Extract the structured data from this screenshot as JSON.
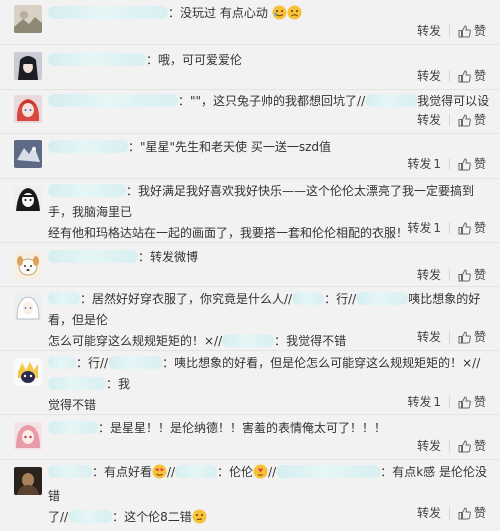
{
  "comments": [
    {
      "text": "：没玩过 有点心动",
      "forward": "转发",
      "like": "赞",
      "forward_count": "",
      "like_count": "",
      "avatar": "landscape-avatar-icon"
    },
    {
      "text": "：哦，可可爱爱伦",
      "forward": "转发",
      "like": "赞",
      "forward_count": "",
      "like_count": "",
      "avatar": "anime-black-hair-avatar-icon"
    },
    {
      "text_a": "：\"\"，这只兔子帅的我都想回坑了//",
      "text_b": "我觉得可以设",
      "forward": "转发",
      "like": "赞",
      "forward_count": "",
      "like_count": "",
      "avatar": "anime-red-hair-avatar-icon"
    },
    {
      "text": "：\"星星\"先生和老天使 买一送一szd值",
      "forward": "转发",
      "like": "赞",
      "forward_count": "1",
      "like_count": "",
      "avatar": "blue-gray-avatar-icon"
    },
    {
      "text_a": "：我好满足我好喜欢我好快乐——这个伦伦太漂亮了我一定要搞到手，我脑海里已",
      "text_b": "经有他和玛格达站在一起的画面了，我要搭一套和伦伦相配的衣服！",
      "forward": "转发",
      "like": "赞",
      "forward_count": "1",
      "like_count": "",
      "avatar": "manga-avatar-icon"
    },
    {
      "text": "：转发微博",
      "forward": "转发",
      "like": "赞",
      "forward_count": "",
      "like_count": "",
      "avatar": "dog-avatar-icon"
    },
    {
      "line1_a": "：居然好好穿衣服了，你究竟是什么人//",
      "line1_b": "：行//",
      "line1_c": "咦比想象的好看，但是伦",
      "line2_a": "怎么可能穿这么规规矩矩的！×//",
      "line2_b": "：我觉得不错",
      "forward": "转发",
      "like": "赞",
      "forward_count": "",
      "like_count": "",
      "avatar": "white-anime-avatar-icon"
    },
    {
      "line1_a": "：行//",
      "line1_b": "：咦比想象的好看，但是伦怎么可能穿这么规规矩矩的！×//",
      "line1_c": "：我",
      "line2": "觉得不错",
      "forward": "转发",
      "like": "赞",
      "forward_count": "1",
      "like_count": "",
      "avatar": "yellow-character-avatar-icon"
    },
    {
      "text": "：是星星！！是伦纳德！！害羞的表情俺太可了！！！",
      "forward": "转发",
      "like": "赞",
      "forward_count": "",
      "like_count": "",
      "avatar": "pink-hair-avatar-icon"
    },
    {
      "line1_a": "：有点好看",
      "line1_b": "：伦伦",
      "line1_c": "：有点k感 是伦伦没错",
      "line2_a": "了//",
      "line2_b": "：这个伦8二错",
      "forward": "转发",
      "like": "赞",
      "forward_count": "",
      "like_count": "",
      "avatar": "dark-portrait-avatar-icon"
    }
  ]
}
